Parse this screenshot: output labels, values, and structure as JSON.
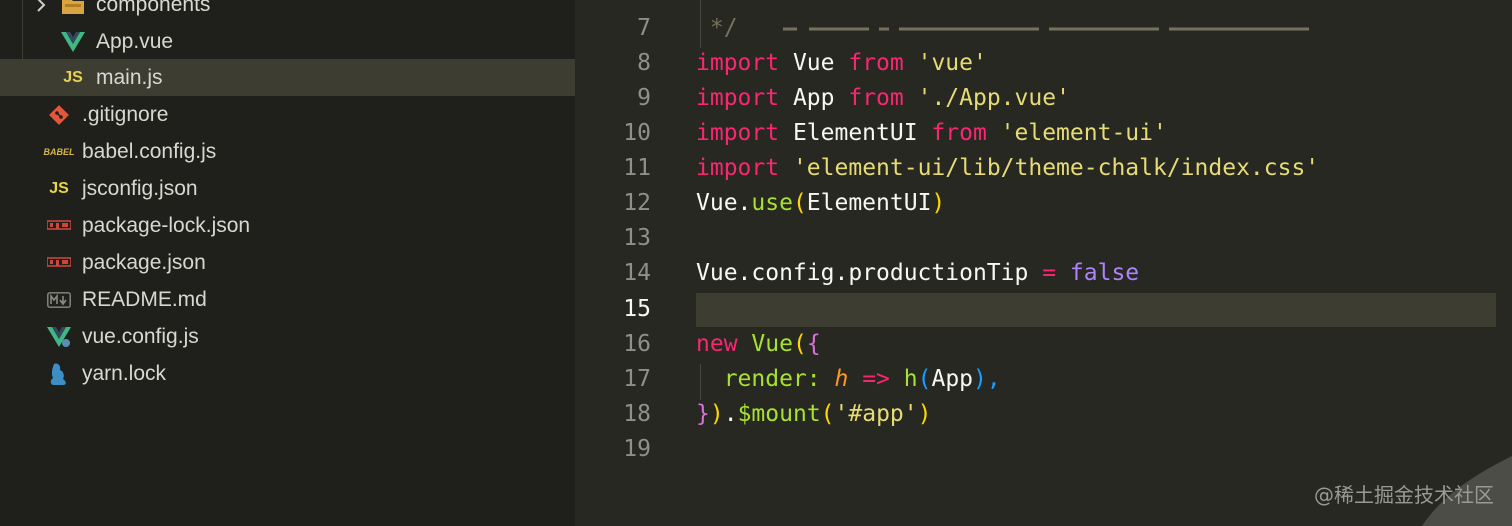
{
  "sidebar": {
    "items": [
      {
        "label": "components",
        "icon": "folder-icon"
      },
      {
        "label": "App.vue",
        "icon": "vue-icon"
      },
      {
        "label": "main.js",
        "icon": "js-icon",
        "selected": true
      },
      {
        "label": ".gitignore",
        "icon": "git-icon"
      },
      {
        "label": "babel.config.js",
        "icon": "babel-icon"
      },
      {
        "label": "jsconfig.json",
        "icon": "js-config-icon"
      },
      {
        "label": "package-lock.json",
        "icon": "npm-icon"
      },
      {
        "label": "package.json",
        "icon": "npm-icon"
      },
      {
        "label": "README.md",
        "icon": "markdown-icon"
      },
      {
        "label": "vue.config.js",
        "icon": "vue-config-icon"
      },
      {
        "label": "yarn.lock",
        "icon": "yarn-icon"
      }
    ],
    "icon_text": {
      "js": "JS",
      "babel": "BABEL"
    }
  },
  "editor": {
    "current_line": "15",
    "lines": [
      {
        "n": "7",
        "text": " */"
      },
      {
        "n": "8",
        "text": "import Vue from 'vue'"
      },
      {
        "n": "9",
        "text": "import App from './App.vue'"
      },
      {
        "n": "10",
        "text": "import ElementUI from 'element-ui'"
      },
      {
        "n": "11",
        "text": "import 'element-ui/lib/theme-chalk/index.css'"
      },
      {
        "n": "12",
        "text": "Vue.use(ElementUI)"
      },
      {
        "n": "13",
        "text": ""
      },
      {
        "n": "14",
        "text": "Vue.config.productionTip = false"
      },
      {
        "n": "15",
        "text": ""
      },
      {
        "n": "16",
        "text": "new Vue({"
      },
      {
        "n": "17",
        "text": "  render: h => h(App),"
      },
      {
        "n": "18",
        "text": "}).$mount('#app')"
      },
      {
        "n": "19",
        "text": ""
      }
    ],
    "tokens": {
      "l7": [
        " */"
      ],
      "l8": [
        "import",
        " Vue ",
        "from",
        " ",
        "'vue'"
      ],
      "l9": [
        "import",
        " App ",
        "from",
        " ",
        "'./App.vue'"
      ],
      "l10": [
        "import",
        " ElementUI ",
        "from",
        " ",
        "'element-ui'"
      ],
      "l11": [
        "import",
        " ",
        "'element-ui/lib/theme-chalk/index.css'"
      ],
      "l12": [
        "Vue.",
        "use",
        "(",
        "ElementUI",
        ")"
      ],
      "l14": [
        "Vue.config.productionTip ",
        "=",
        " ",
        "false"
      ],
      "l16": [
        "new",
        " ",
        "Vue",
        "(",
        "{"
      ],
      "l17": [
        "  render: ",
        "h",
        " ",
        "=>",
        " ",
        "h",
        "(",
        "App",
        "),"
      ],
      "l18": [
        "}",
        ")",
        ".",
        "$mount",
        "(",
        "'#app'",
        ")"
      ]
    }
  },
  "watermark": "@稀土掘金技术社区",
  "colors": {
    "keyword": "#f92672",
    "string": "#e6db74",
    "function": "#a6e22e",
    "boolean": "#ae81ff",
    "argument": "#fd971f",
    "sidebar_bg": "#1f201b",
    "editor_bg": "#272822"
  }
}
